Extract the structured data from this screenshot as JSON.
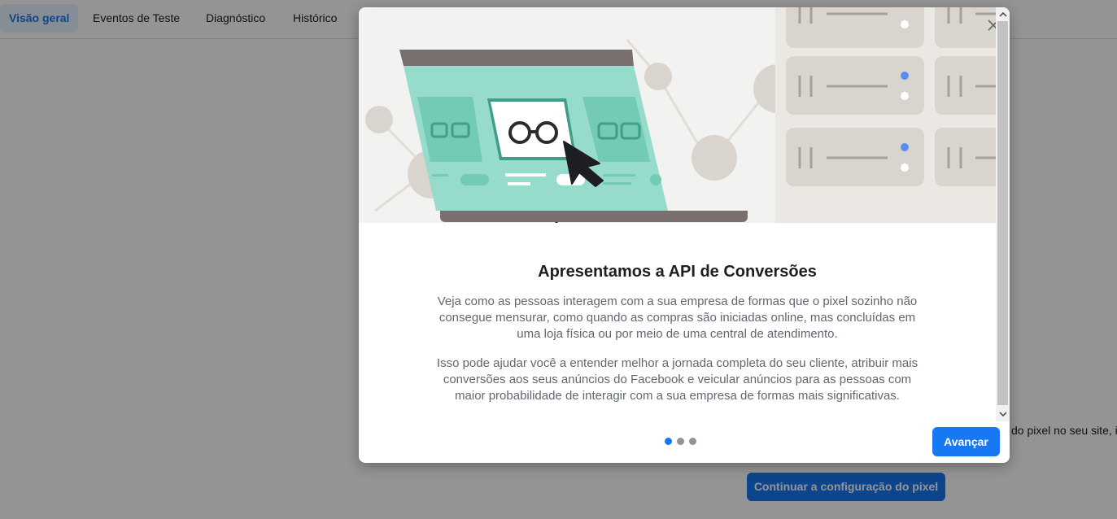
{
  "tabs": [
    {
      "label": "Visão geral",
      "active": true
    },
    {
      "label": "Eventos de Teste",
      "active": false
    },
    {
      "label": "Diagnóstico",
      "active": false
    },
    {
      "label": "Histórico",
      "active": false
    }
  ],
  "background": {
    "partial_text": "do pixel no seu site, i",
    "continue_button": "Continuar a configuração do pixel"
  },
  "modal": {
    "title": "Apresentamos a API de Conversões",
    "paragraphs": [
      "Veja como as pessoas interagem com a sua empresa de formas que o pixel sozinho não consegue mensurar, como quando as compras são iniciadas online, mas concluídas em uma loja física ou por meio de uma central de atendimento.",
      "Isso pode ajudar você a entender melhor a jornada completa do seu cliente, atribuir mais conversões aos seus anúncios do Facebook e veicular anúncios para as pessoas com maior probabilidade de interagir com a sua empresa de formas mais significativas."
    ],
    "next_button": "Avançar",
    "pagination": {
      "total": 3,
      "current": 1
    },
    "icons": {
      "close": "close-icon",
      "scroll_up": "chevron-up-icon",
      "scroll_down": "chevron-down-icon"
    }
  },
  "colors": {
    "accent": "#1877f2",
    "hero_background": "#f2f2f0",
    "laptop_screen": "#97dbcd",
    "server_panel": "#d9d4ce"
  }
}
